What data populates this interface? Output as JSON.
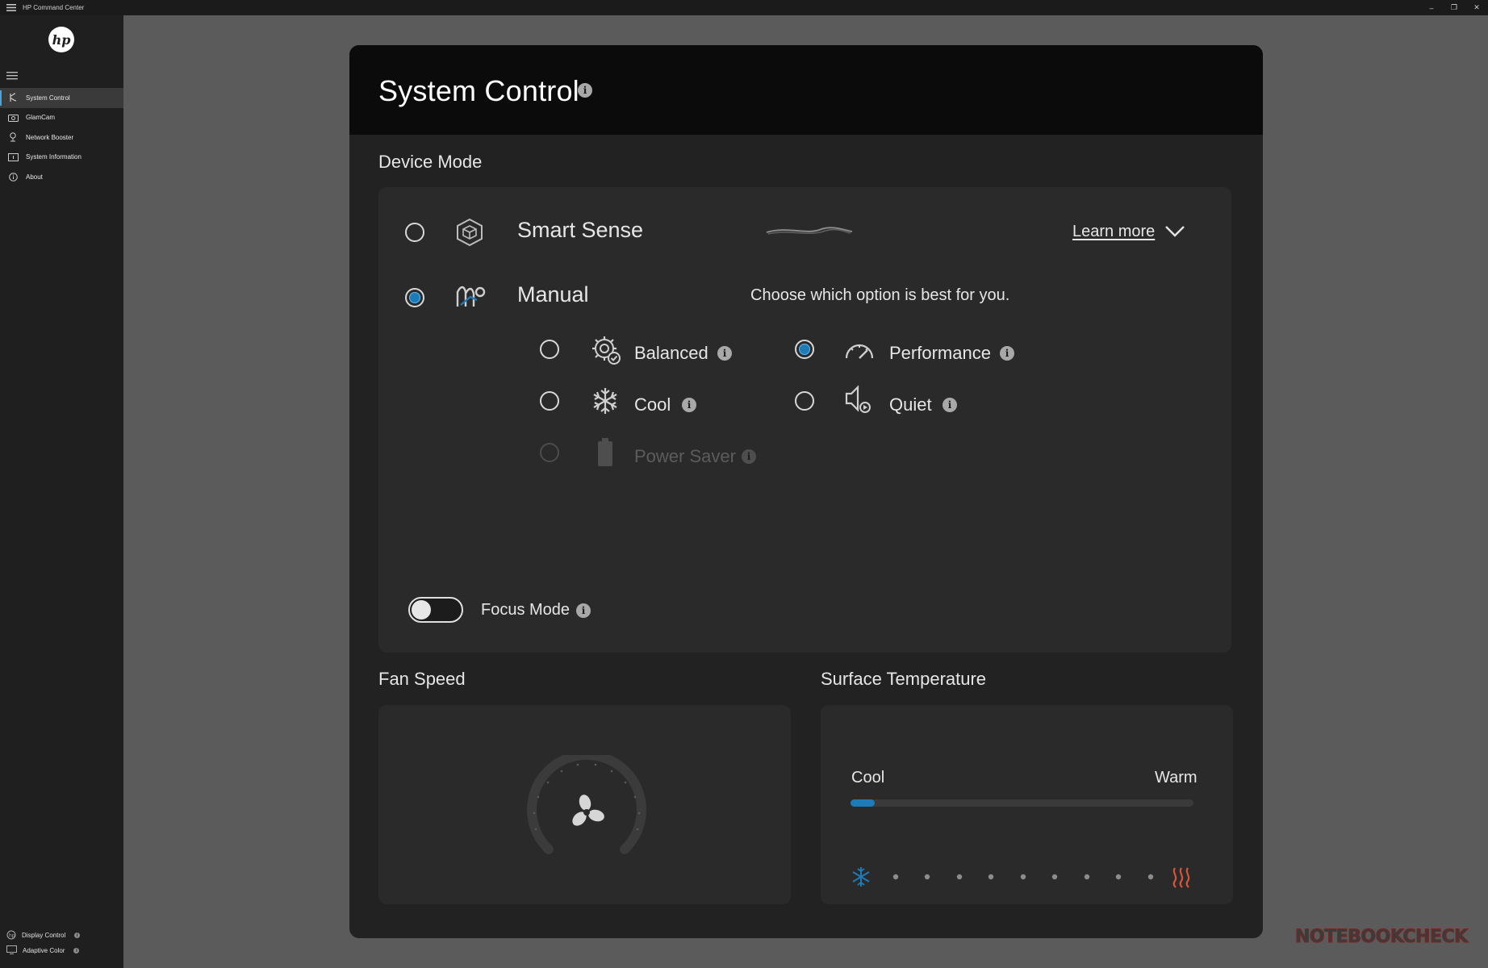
{
  "window": {
    "title": "HP Command Center"
  },
  "sidebar": {
    "logo": "hp",
    "items": [
      {
        "label": "System Control",
        "icon": "system-control-icon",
        "active": true
      },
      {
        "label": "GlamCam",
        "icon": "camera-icon",
        "active": false
      },
      {
        "label": "Network Booster",
        "icon": "network-icon",
        "active": false
      },
      {
        "label": "System Information",
        "icon": "info-screen-icon",
        "active": false
      },
      {
        "label": "About",
        "icon": "about-icon",
        "active": false
      }
    ],
    "bottom_items": [
      {
        "label": "Display Control",
        "icon": "display-control-icon"
      },
      {
        "label": "Adaptive Color",
        "icon": "monitor-icon"
      }
    ]
  },
  "main": {
    "title": "System Control",
    "device_mode": {
      "section_label": "Device Mode",
      "modes": [
        {
          "label": "Smart Sense",
          "selected": false,
          "icon": "cube-icon"
        },
        {
          "label": "Manual",
          "selected": true,
          "icon": "manual-wave-icon"
        }
      ],
      "learn_more": "Learn more",
      "hint": "Choose which option is best for you.",
      "manual_options": [
        {
          "label": "Balanced",
          "selected": false,
          "disabled": false,
          "icon": "gear-check-icon"
        },
        {
          "label": "Performance",
          "selected": true,
          "disabled": false,
          "icon": "speedometer-icon"
        },
        {
          "label": "Cool",
          "selected": false,
          "disabled": false,
          "icon": "snowflake-icon"
        },
        {
          "label": "Quiet",
          "selected": false,
          "disabled": false,
          "icon": "speaker-icon"
        },
        {
          "label": "Power Saver",
          "selected": false,
          "disabled": true,
          "icon": "battery-icon"
        }
      ]
    },
    "focus_mode": {
      "label": "Focus Mode",
      "enabled": false
    },
    "fan_speed": {
      "section_label": "Fan Speed",
      "icon": "fan-icon"
    },
    "surface_temperature": {
      "section_label": "Surface Temperature",
      "min_label": "Cool",
      "max_label": "Warm",
      "level": 0.07,
      "accent_color": "#1f7ab8",
      "warm_color": "#d4553a"
    }
  },
  "watermark": "NOTEBOOKCHECK",
  "colors": {
    "accent": "#1f7ab8",
    "panel": "#222222",
    "header": "#0b0b0b",
    "card": "#2a2a2a"
  }
}
